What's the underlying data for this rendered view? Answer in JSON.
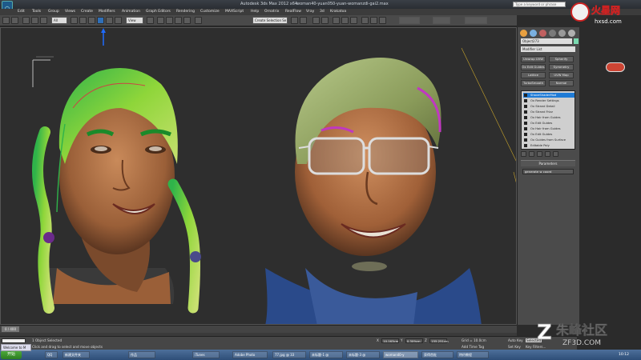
{
  "titlebar": {
    "title": "Autodesk 3ds Max  2012 x64",
    "file": "woman40-yuan050-yuan-womanzdi-gai2.max",
    "search_placeholder": "Type a keyword or phrase"
  },
  "menu": [
    "Edit",
    "Tools",
    "Group",
    "Views",
    "Create",
    "Modifiers",
    "Animation",
    "Graph Editors",
    "Rendering",
    "Customize",
    "MAXScript",
    "Help",
    "Ornatrix",
    "RealFlow",
    "Vray",
    "3d",
    "Krakatoa"
  ],
  "toolbar": {
    "selection_set": "Create Selection Se",
    "view_dropdown": "View"
  },
  "command_panel": {
    "object_name": "Object273",
    "object_color": "#7ad9b0",
    "modifier_list": "Modifier List",
    "buttons": [
      "Unwrap UVW",
      "TurboSmooth",
      "Ox Edit Guides",
      "Lattice",
      "TurboSmooth",
      "Spherify",
      "Symmetry",
      "UVW Map",
      "Normal"
    ],
    "stack": [
      {
        "label": "ShaveShaderMod",
        "selected": true
      },
      {
        "label": "Ox Render Settings",
        "selected": false
      },
      {
        "label": "Ox Strand Detail",
        "selected": false
      },
      {
        "label": "Ox Strand Frizz",
        "selected": false
      },
      {
        "label": "Ox Hair from Guides",
        "selected": false
      },
      {
        "label": "Ox Edit Guides",
        "selected": false
      },
      {
        "label": "Ox Hair from Guides",
        "selected": false
      },
      {
        "label": "Ox Edit Guides",
        "selected": false
      },
      {
        "label": "Ox Guides from Surface",
        "selected": false
      },
      {
        "label": "Editable Poly",
        "selected": false
      }
    ],
    "parameters_title": "Parameters",
    "parameters_value": "generate w coord"
  },
  "viewport": {
    "label": "Perspective"
  },
  "timeslider": {
    "frame": "0 / 400"
  },
  "status": {
    "objects": "1 Object Selected",
    "hint": "Click and drag to select and move objects",
    "x": "10.163cm",
    "y": "0.309cm",
    "z": "155.251cm",
    "grid": "Grid = 10.0cm",
    "auto_key": "Auto Key",
    "selected": "Selected",
    "set_key": "Set Key",
    "key_filters": "Key Filters...",
    "add_time_tag": "Add Time Tag"
  },
  "taskbar": {
    "start": "开始",
    "items": [
      "Welcome to M",
      "QQ",
      "新建文件夹",
      "作品",
      "iTunes",
      "Adobe Photo",
      "77.jpg @ 33",
      "未标题-1 @",
      "未标题-3 @",
      "woman40-y",
      "获得首批",
      "特约教程"
    ],
    "clock": "10:12"
  },
  "watermarks": {
    "top": "火星网",
    "top_url": "hxsd.com",
    "bottom": "朱峰社区",
    "bottom_url": "ZF3D.COM"
  }
}
